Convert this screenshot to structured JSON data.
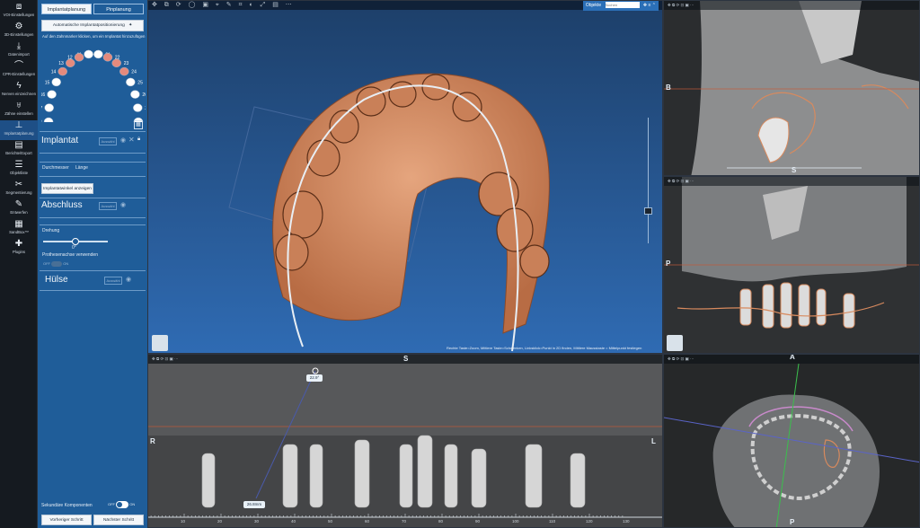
{
  "toolbar": {
    "items": [
      {
        "label": "VOI-Einstellungen",
        "icon": "cube"
      },
      {
        "label": "3D-Einstellungen",
        "icon": "gear"
      },
      {
        "label": "Datenimport",
        "icon": "download"
      },
      {
        "label": "CPR-Einstellungen",
        "icon": "curve"
      },
      {
        "label": "Nerven einzeichnen",
        "icon": "nerve"
      },
      {
        "label": "Zähne einstellen",
        "icon": "tooth"
      },
      {
        "label": "Implantatplanung",
        "icon": "implant"
      },
      {
        "label": "Berichte/Export",
        "icon": "report"
      },
      {
        "label": "Objektliste",
        "icon": "list"
      },
      {
        "label": "Segmentierung",
        "icon": "segment"
      },
      {
        "label": "Entwerfen",
        "icon": "design"
      },
      {
        "label": "SandBox™",
        "icon": "sandbox"
      },
      {
        "label": "Plugins",
        "icon": "puzzle"
      }
    ]
  },
  "panel": {
    "tabs": [
      "Implantatplanung",
      "Pinplanung"
    ],
    "auto_button": "Automatische Implantatpositionierung",
    "hint": "Auf den Zahnmarker klicken, um ein Implantat hinzuzufügen",
    "teeth_numbers": [
      "11",
      "21",
      "12",
      "22",
      "13",
      "23",
      "14",
      "24",
      "15",
      "25",
      "16",
      "26",
      "17",
      "27",
      "18",
      "28"
    ],
    "implant": {
      "title": "Implantat",
      "placeholder_btn": "Auswähl",
      "diameter_label": "Durchmesser",
      "length_label": "Länge",
      "show_angle_btn": "Implantatwinkel anzeigen"
    },
    "abutment": {
      "title": "Abschluss",
      "placeholder_btn": "Auswähl",
      "rotation_label": "Drehung",
      "rotation_value": "0°",
      "prosthetic_label": "Prothesenachse verwenden",
      "toggle_off": "OFF",
      "toggle_on": "ON"
    },
    "sleeve": {
      "title": "Hülse",
      "placeholder_btn": "Auswähl"
    },
    "secondary": {
      "label": "Sekundäre Komponenten",
      "off": "OFF",
      "on": "ON"
    },
    "prev_button": "Vorheriger Schritt",
    "next_button": "Nächster Schritt"
  },
  "view3d": {
    "objects_label": "Objekte",
    "search_placeholder": "Suchen",
    "status_text": "Rechte Taste=Zoom, Mittlere Taste=Schwenken, Linksklick=Punkt in 2D finden, Mittlere Mausstaste = Mittelpunkt festlegen"
  },
  "panoramic": {
    "top_label": "S",
    "left_label": "R",
    "right_label": "L",
    "angle": "22.9°",
    "measurement": "26.8mm",
    "ruler_ticks": [
      "10",
      "20",
      "30",
      "40",
      "50",
      "60",
      "70",
      "80",
      "90",
      "100",
      "110",
      "120",
      "130"
    ]
  },
  "sagittal": {
    "left_label": "B",
    "bottom_label": "S"
  },
  "coronal": {
    "left_label": "P"
  },
  "axial": {
    "top_label": "A",
    "bottom_label": "P"
  },
  "colors": {
    "panel_blue": "#1f5d99",
    "bone_orange": "#d88a5e",
    "bg_3d_top": "#1d3f69",
    "bg_3d_bottom": "#2f6bb3"
  }
}
